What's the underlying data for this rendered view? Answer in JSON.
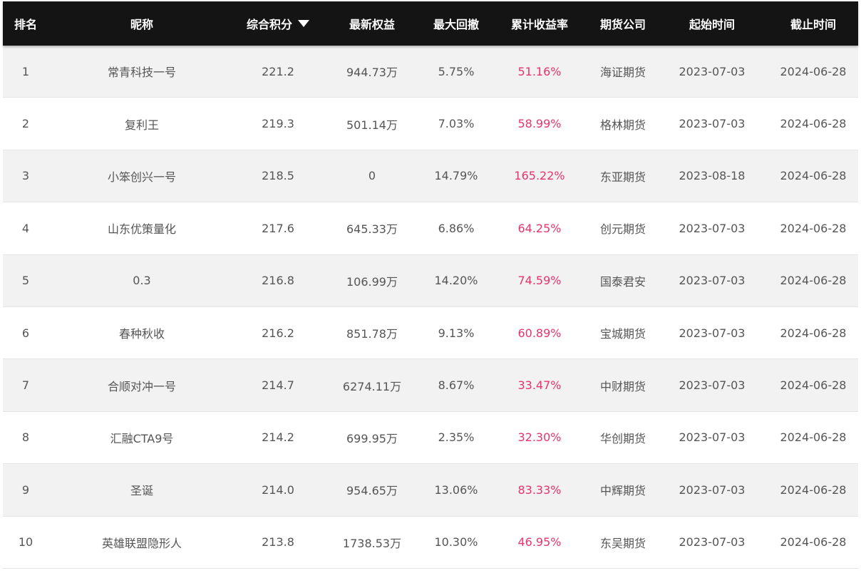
{
  "header": {
    "rank": "排名",
    "nickname": "昵称",
    "score": "综合积分",
    "equity": "最新权益",
    "drawdown": "最大回撤",
    "cum_return": "累计收益率",
    "broker": "期货公司",
    "start": "起始时间",
    "end": "截止时间"
  },
  "colors": {
    "header_bg": "#141414",
    "return_text": "#e8336d",
    "row_alt": "#f2f2f2"
  },
  "rows": [
    {
      "rank": "1",
      "nickname": "常青科技一号",
      "score": "221.2",
      "equity": "944.73万",
      "drawdown": "5.75%",
      "cum_return": "51.16%",
      "broker": "海证期货",
      "start": "2023-07-03",
      "end": "2024-06-28"
    },
    {
      "rank": "2",
      "nickname": "复利王",
      "score": "219.3",
      "equity": "501.14万",
      "drawdown": "7.03%",
      "cum_return": "58.99%",
      "broker": "格林期货",
      "start": "2023-07-03",
      "end": "2024-06-28"
    },
    {
      "rank": "3",
      "nickname": "小笨创兴一号",
      "score": "218.5",
      "equity": "0",
      "drawdown": "14.79%",
      "cum_return": "165.22%",
      "broker": "东亚期货",
      "start": "2023-08-18",
      "end": "2024-06-28"
    },
    {
      "rank": "4",
      "nickname": "山东优策量化",
      "score": "217.6",
      "equity": "645.33万",
      "drawdown": "6.86%",
      "cum_return": "64.25%",
      "broker": "创元期货",
      "start": "2023-07-03",
      "end": "2024-06-28"
    },
    {
      "rank": "5",
      "nickname": "0.3",
      "score": "216.8",
      "equity": "106.99万",
      "drawdown": "14.20%",
      "cum_return": "74.59%",
      "broker": "国泰君安",
      "start": "2023-07-03",
      "end": "2024-06-28"
    },
    {
      "rank": "6",
      "nickname": "春种秋收",
      "score": "216.2",
      "equity": "851.78万",
      "drawdown": "9.13%",
      "cum_return": "60.89%",
      "broker": "宝城期货",
      "start": "2023-07-03",
      "end": "2024-06-28"
    },
    {
      "rank": "7",
      "nickname": "合顺对冲一号",
      "score": "214.7",
      "equity": "6274.11万",
      "drawdown": "8.67%",
      "cum_return": "33.47%",
      "broker": "中财期货",
      "start": "2023-07-03",
      "end": "2024-06-28"
    },
    {
      "rank": "8",
      "nickname": "汇融CTA9号",
      "score": "214.2",
      "equity": "699.95万",
      "drawdown": "2.35%",
      "cum_return": "32.30%",
      "broker": "华创期货",
      "start": "2023-07-03",
      "end": "2024-06-28"
    },
    {
      "rank": "9",
      "nickname": "圣诞",
      "score": "214.0",
      "equity": "954.65万",
      "drawdown": "13.06%",
      "cum_return": "83.33%",
      "broker": "中辉期货",
      "start": "2023-07-03",
      "end": "2024-06-28"
    },
    {
      "rank": "10",
      "nickname": "英雄联盟隐形人",
      "score": "213.8",
      "equity": "1738.53万",
      "drawdown": "10.30%",
      "cum_return": "46.95%",
      "broker": "东吴期货",
      "start": "2023-07-03",
      "end": "2024-06-28"
    }
  ]
}
